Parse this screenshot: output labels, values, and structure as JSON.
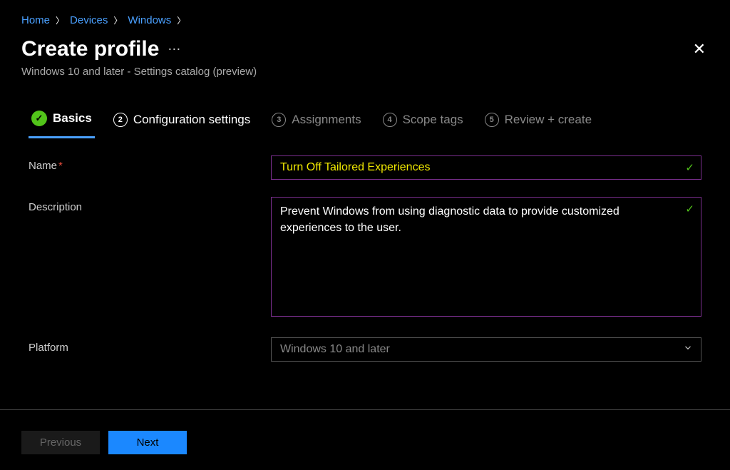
{
  "breadcrumb": [
    {
      "label": "Home"
    },
    {
      "label": "Devices"
    },
    {
      "label": "Windows"
    }
  ],
  "header": {
    "title": "Create profile",
    "subtitle": "Windows 10 and later - Settings catalog (preview)"
  },
  "tabs": [
    {
      "num": "1",
      "label": "Basics",
      "state": "complete"
    },
    {
      "num": "2",
      "label": "Configuration settings",
      "state": "available"
    },
    {
      "num": "3",
      "label": "Assignments",
      "state": "disabled"
    },
    {
      "num": "4",
      "label": "Scope tags",
      "state": "disabled"
    },
    {
      "num": "5",
      "label": "Review + create",
      "state": "disabled"
    }
  ],
  "form": {
    "name_label": "Name",
    "name_value": "Turn Off Tailored Experiences",
    "desc_label": "Description",
    "desc_value": "Prevent Windows from using diagnostic data to provide customized experiences to the user.",
    "platform_label": "Platform",
    "platform_value": "Windows 10 and later"
  },
  "footer": {
    "previous": "Previous",
    "next": "Next"
  }
}
